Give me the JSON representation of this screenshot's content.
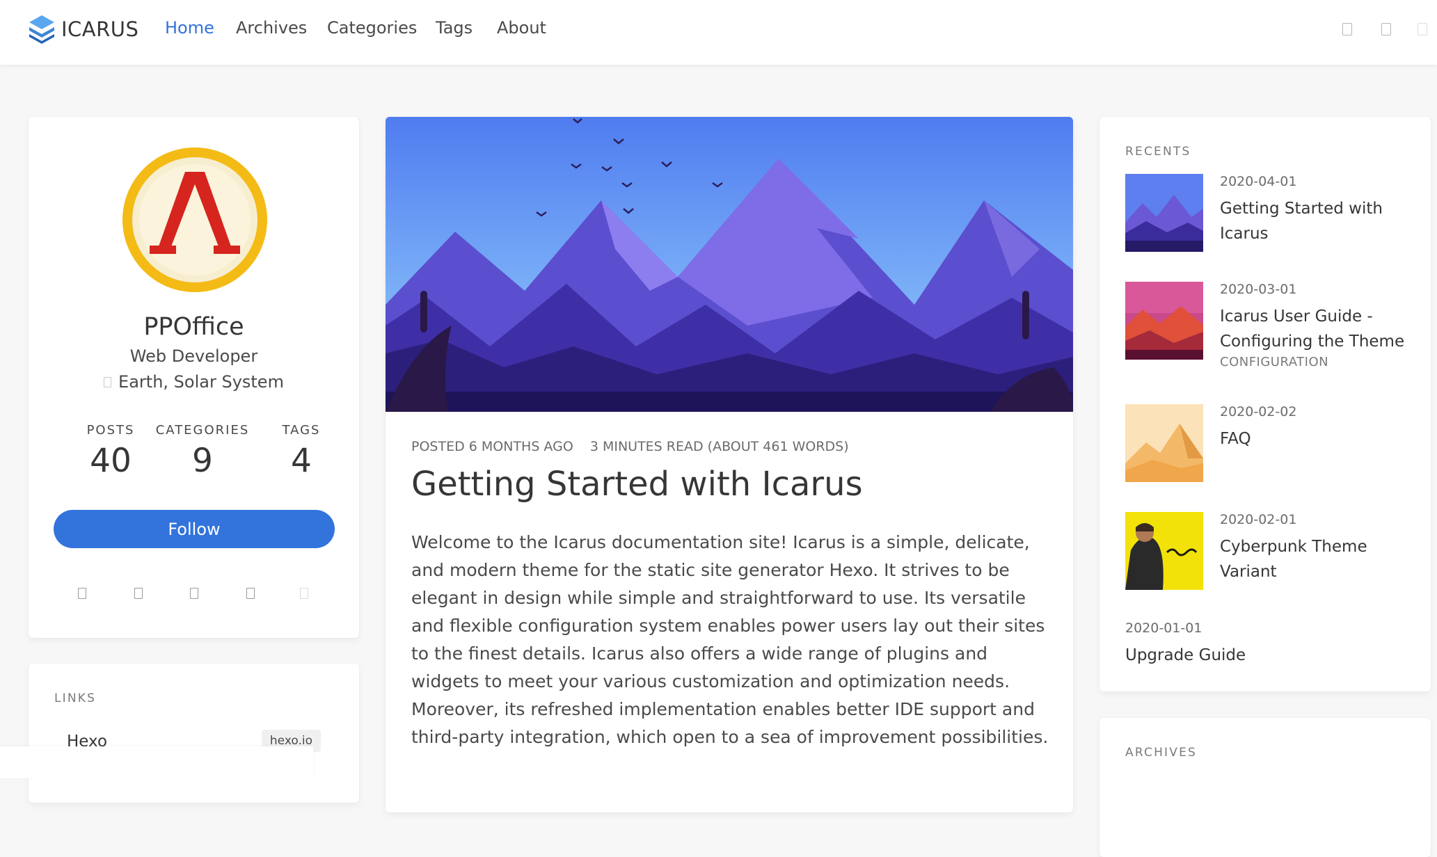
{
  "navbar": {
    "brand": "ICARUS",
    "items": [
      "Home",
      "Archives",
      "Categories",
      "Tags",
      "About"
    ],
    "active": "Home",
    "right_icons": [
      "search-icon",
      "github-icon",
      "catalogue-icon"
    ]
  },
  "profile": {
    "name": "PPOffice",
    "role": "Web Developer",
    "location": "Earth, Solar System",
    "stats": [
      {
        "label": "POSTS",
        "value": "40"
      },
      {
        "label": "CATEGORIES",
        "value": "9"
      },
      {
        "label": "TAGS",
        "value": "4"
      }
    ],
    "follow_label": "Follow",
    "social_icons": [
      "github-icon",
      "facebook-icon",
      "twitter-icon",
      "dribbble-icon",
      "rss-icon"
    ]
  },
  "links": {
    "heading": "LINKS",
    "items": [
      {
        "name": "Hexo",
        "url_label": "hexo.io"
      }
    ]
  },
  "article": {
    "posted": "POSTED 6 MONTHS AGO",
    "reading": "3 MINUTES READ (ABOUT 461 WORDS)",
    "title": "Getting Started with Icarus",
    "body": "Welcome to the Icarus documentation site! Icarus is a simple, delicate, and modern theme for the static site generator Hexo. It strives to be elegant in design while simple and straightforward to use. Its versatile and flexible configuration system enables power users lay out their sites to the finest details. Icarus also offers a wide range of plugins and widgets to meet your various customization and optimization needs. Moreover, its refreshed implementation enables better IDE support and third-party integration, which open to a sea of improvement possibilities."
  },
  "recents": {
    "heading": "RECENTS",
    "items": [
      {
        "date": "2020-04-01",
        "title": "Getting Started with Icarus",
        "category": ""
      },
      {
        "date": "2020-03-01",
        "title": "Icarus User Guide - Configuring the Theme",
        "category": "CONFIGURATION"
      },
      {
        "date": "2020-02-02",
        "title": "FAQ",
        "category": ""
      },
      {
        "date": "2020-02-01",
        "title": "Cyberpunk Theme Variant",
        "category": ""
      },
      {
        "date": "2020-01-01",
        "title": "Upgrade Guide",
        "category": ""
      }
    ]
  },
  "archives": {
    "heading": "ARCHIVES"
  },
  "colors": {
    "accent": "#3273dc",
    "background": "#f7f7f7",
    "card": "#ffffff",
    "text": "#363636"
  }
}
